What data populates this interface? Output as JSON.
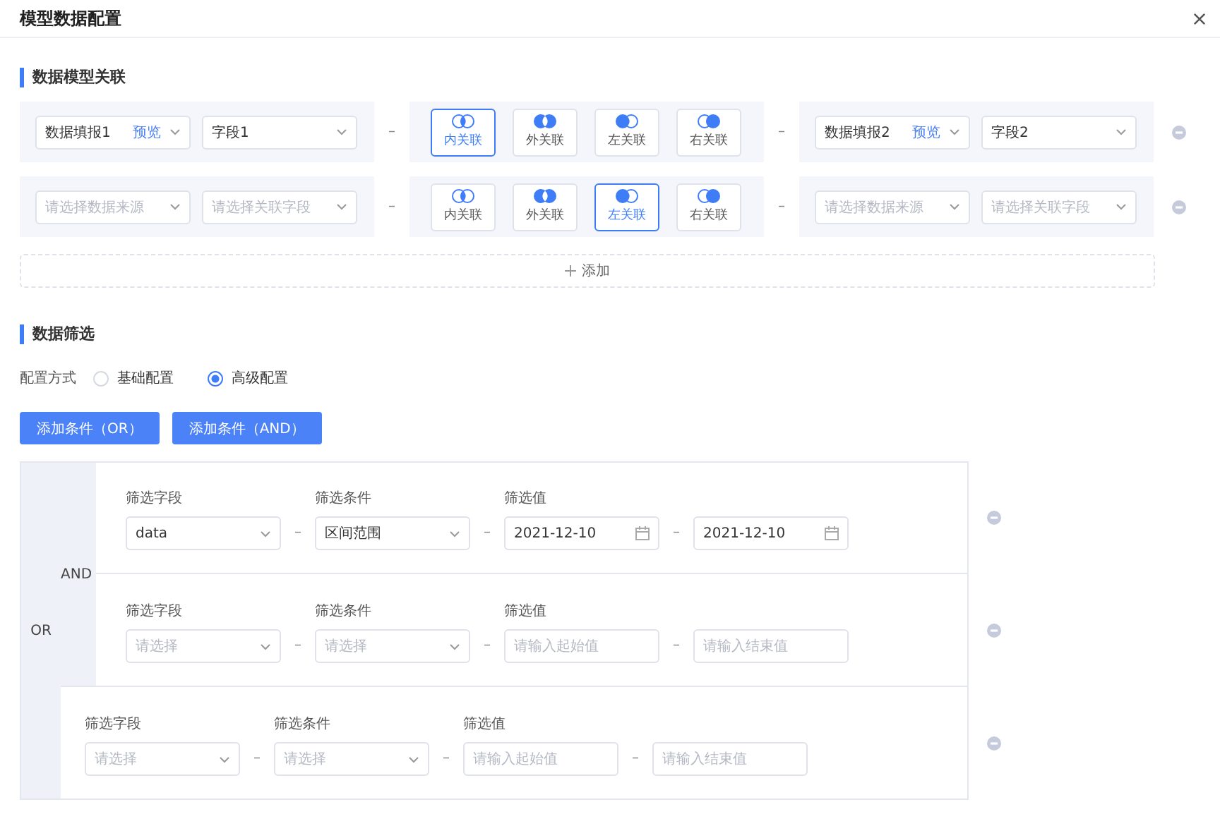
{
  "dialog": {
    "title": "模型数据配置"
  },
  "join_section": {
    "heading": "数据模型关联",
    "separator": "–",
    "rows": [
      {
        "left_source": {
          "value": "数据填报1",
          "link": "预览"
        },
        "left_field": {
          "value": "字段1"
        },
        "joins": [
          {
            "kind": "inner",
            "label": "内关联",
            "selected": true
          },
          {
            "kind": "outer",
            "label": "外关联",
            "selected": false
          },
          {
            "kind": "left",
            "label": "左关联",
            "selected": false
          },
          {
            "kind": "right",
            "label": "右关联",
            "selected": false
          }
        ],
        "right_source": {
          "value": "数据填报2",
          "link": "预览"
        },
        "right_field": {
          "value": "字段2"
        }
      },
      {
        "left_source": {
          "placeholder": "请选择数据来源"
        },
        "left_field": {
          "placeholder": "请选择关联字段"
        },
        "joins": [
          {
            "kind": "inner",
            "label": "内关联",
            "selected": false
          },
          {
            "kind": "outer",
            "label": "外关联",
            "selected": false
          },
          {
            "kind": "left",
            "label": "左关联",
            "selected": true
          },
          {
            "kind": "right",
            "label": "右关联",
            "selected": false
          }
        ],
        "right_source": {
          "placeholder": "请选择数据来源"
        },
        "right_field": {
          "placeholder": "请选择关联字段"
        }
      }
    ],
    "add_button": "添加"
  },
  "filter_section": {
    "heading": "数据筛选",
    "mode_label": "配置方式",
    "modes": [
      {
        "label": "基础配置",
        "selected": false
      },
      {
        "label": "高级配置",
        "selected": true
      }
    ],
    "buttons": [
      "添加条件（OR）",
      "添加条件（AND）"
    ],
    "or_label": "OR",
    "separator": "–",
    "groups": [
      {
        "and_label": "AND",
        "conditions": [
          {
            "field_label": "筛选字段",
            "field": {
              "value": "data"
            },
            "op_label": "筛选条件",
            "op": {
              "value": "区间范围"
            },
            "value_label": "筛选值",
            "start": {
              "kind": "date",
              "value": "2021-12-10"
            },
            "end": {
              "kind": "date",
              "value": "2021-12-10"
            }
          },
          {
            "field_label": "筛选字段",
            "field": {
              "placeholder": "请选择"
            },
            "op_label": "筛选条件",
            "op": {
              "placeholder": "请选择"
            },
            "value_label": "筛选值",
            "start": {
              "kind": "text",
              "placeholder": "请输入起始值"
            },
            "end": {
              "kind": "text",
              "placeholder": "请输入结束值"
            }
          }
        ]
      },
      {
        "conditions": [
          {
            "field_label": "筛选字段",
            "field": {
              "placeholder": "请选择"
            },
            "op_label": "筛选条件",
            "op": {
              "placeholder": "请选择"
            },
            "value_label": "筛选值",
            "start": {
              "kind": "text",
              "placeholder": "请输入起始值"
            },
            "end": {
              "kind": "text",
              "placeholder": "请输入结束值"
            }
          }
        ]
      }
    ]
  }
}
